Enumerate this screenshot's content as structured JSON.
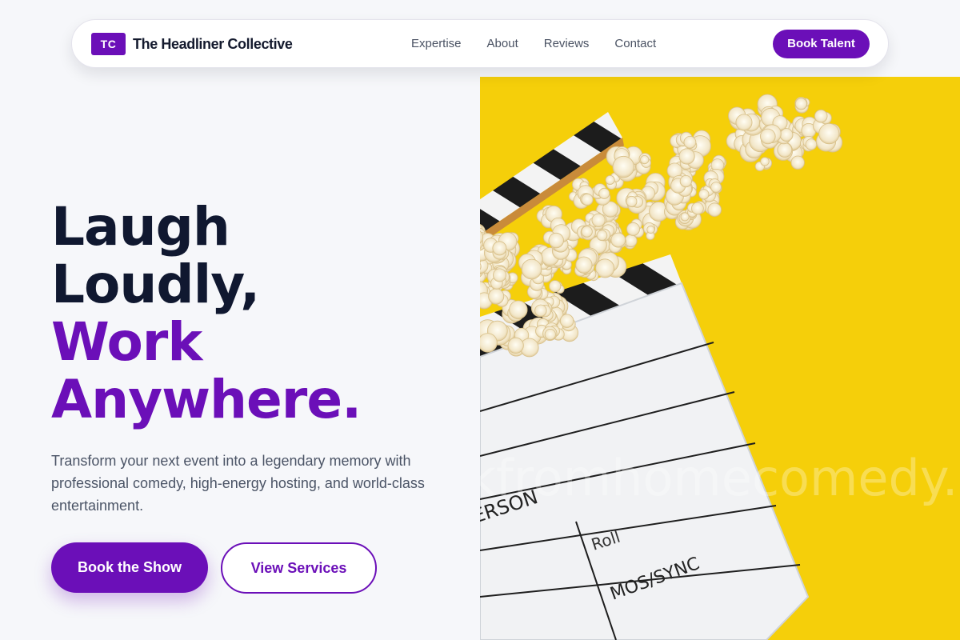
{
  "brand": {
    "logo_initials": "TC",
    "name": "The Headliner Collective"
  },
  "nav": {
    "links": [
      "Expertise",
      "About",
      "Reviews",
      "Contact"
    ],
    "cta_label": "Book Talent"
  },
  "hero": {
    "title_lines": [
      "Laugh",
      "Loudly,",
      "Work",
      "Anywhere."
    ],
    "description": "Transform your next event into a legendary memory with professional comedy, high-energy hosting, and world-class entertainment.",
    "primary_button": "Book the Show",
    "secondary_button": "View Services"
  },
  "image": {
    "watermark": "kfromhomecomedy.c",
    "clapper_labels": [
      "ERSON",
      "Roll",
      "MOS/SYNC"
    ]
  },
  "colors": {
    "accent": "#6b0fb8",
    "heading": "#101830",
    "body_text": "#4b5466",
    "page_background": "#f6f7fa",
    "image_background": "#f5cf0a"
  }
}
